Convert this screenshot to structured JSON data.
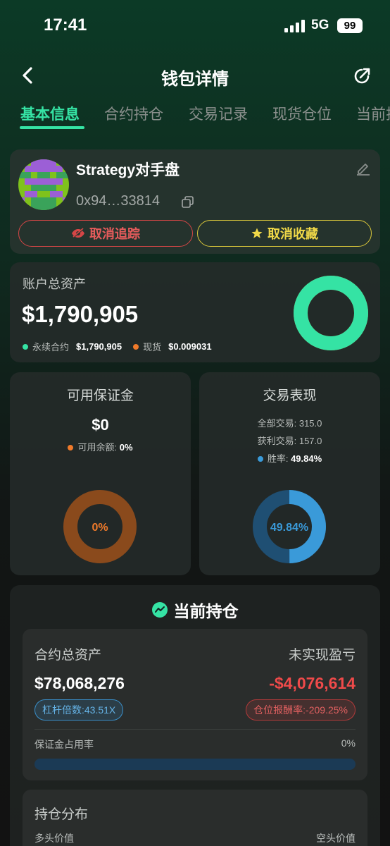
{
  "status_bar": {
    "time": "17:41",
    "network": "5G",
    "battery": "99"
  },
  "nav": {
    "title": "钱包详情"
  },
  "tabs": [
    {
      "label": "基本信息",
      "active": true
    },
    {
      "label": "合约持仓"
    },
    {
      "label": "交易记录"
    },
    {
      "label": "现货仓位"
    },
    {
      "label": "当前挂"
    }
  ],
  "profile": {
    "name": "Strategy对手盘",
    "address": "0x94…33814",
    "untrack_label": "取消追踪",
    "unfavorite_label": "取消收藏"
  },
  "account": {
    "label": "账户总资产",
    "total": "$1,790,905",
    "perp_label": "永续合约",
    "perp_value": "$1,790,905",
    "spot_label": "现货",
    "spot_value": "$0.009031",
    "perp_fraction": 1.0
  },
  "margin": {
    "title": "可用保证金",
    "value": "$0",
    "available_label": "可用余额:",
    "available_pct": "0%",
    "ring_label": "0%",
    "fraction": 0
  },
  "performance": {
    "title": "交易表现",
    "total_trades_label": "全部交易:",
    "total_trades": "315.0",
    "winning_trades_label": "获利交易:",
    "winning_trades": "157.0",
    "win_rate_label": "胜率:",
    "win_rate": "49.84%",
    "ring_label": "49.84%",
    "fraction": 0.4984
  },
  "positions": {
    "title": "当前持仓",
    "total_assets_label": "合约总资产",
    "total_assets": "$78,068,276",
    "unrealized_label": "未实现盈亏",
    "unrealized": "-$4,076,614",
    "leverage": "杠杆倍数:43.51X",
    "roe": "仓位报酬率:-209.25%",
    "margin_usage_label": "保证金占用率",
    "margin_usage": "0%",
    "margin_usage_fraction": 0
  },
  "distribution": {
    "title": "持仓分布",
    "long_label": "多头价值",
    "short_label": "空头价值"
  },
  "colors": {
    "accent": "#35e3a4",
    "perp": "#35e3a4",
    "spot": "#f07a2a",
    "margin_ring": "#8a4a1c",
    "margin_text": "#f07a2a",
    "win": "#3a9ad9",
    "win_track": "#1f4f73",
    "loss": "#ef4a4a"
  }
}
